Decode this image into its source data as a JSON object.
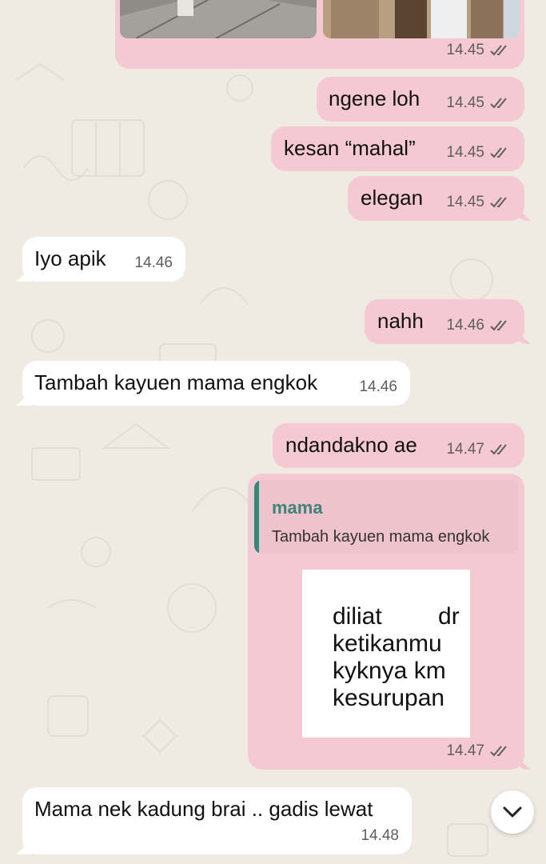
{
  "messages": [
    {
      "direction": "outgoing",
      "type": "media",
      "time": "14.45",
      "status": "read"
    },
    {
      "direction": "outgoing",
      "text": "ngene loh",
      "time": "14.45",
      "status": "read"
    },
    {
      "direction": "outgoing",
      "text": "kesan “mahal”",
      "time": "14.45",
      "status": "read"
    },
    {
      "direction": "outgoing",
      "text": "elegan",
      "time": "14.45",
      "status": "read"
    },
    {
      "direction": "incoming",
      "text": "Iyo apik",
      "time": "14.46"
    },
    {
      "direction": "outgoing",
      "text": "nahh",
      "time": "14.46",
      "status": "read"
    },
    {
      "direction": "incoming",
      "text": "Tambah kayuen mama engkok",
      "time": "14.46"
    },
    {
      "direction": "outgoing",
      "text": "ndandakno ae",
      "time": "14.47",
      "status": "read"
    },
    {
      "direction": "outgoing",
      "type": "reply-sticker",
      "time": "14.47",
      "status": "read",
      "quote": {
        "author": "mama",
        "text": "Tambah kayuen mama engkok"
      },
      "sticker_lines": [
        "diliat dr",
        "ketikanmu",
        "kyknya km",
        "kesurupan"
      ]
    },
    {
      "direction": "incoming",
      "text": "Mama nek kadung brai .. gadis lewat",
      "time": "14.48"
    }
  ],
  "colors": {
    "outgoing": "#f5c9d3",
    "incoming": "#ffffff",
    "quote_accent": "#3f8478",
    "background": "#efeae2"
  },
  "icons": {
    "read_receipt": "double-check-icon",
    "scroll_down": "chevron-down-icon"
  }
}
